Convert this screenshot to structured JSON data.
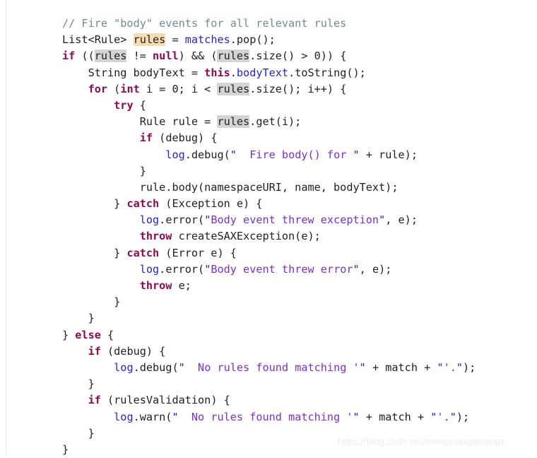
{
  "viewer": {
    "name": "java-source-code-snippet",
    "language": "Java",
    "background": "#ffffff"
  },
  "colors": {
    "comment": "#6f8c8c",
    "keyword": "#8e0a4c",
    "identifier": "#2323dd",
    "string": "#7a2fd4",
    "plain": "#202124",
    "highlight_active": "#f8dcb0",
    "highlight_occurrence": "#d4d4d4",
    "watermark": "#ececec"
  },
  "watermark": {
    "text": "https://blog.csdn.net/mengxiangqihangz"
  },
  "code": {
    "lines": [
      {
        "n": 1,
        "text": "// Fire \"body\" events for all relevant rules",
        "tokens": [
          {
            "t": "// Fire \"body\" events for all relevant rules",
            "c": "t-comment"
          }
        ]
      },
      {
        "n": 2,
        "text": "List<Rule> rules = matches.pop();",
        "tokens": [
          {
            "t": "List<Rule> ",
            "c": "t-plain"
          },
          {
            "t": "rules",
            "c": "t-plain",
            "hl": "hl-active"
          },
          {
            "t": " = ",
            "c": "t-plain"
          },
          {
            "t": "matches",
            "c": "t-ident"
          },
          {
            "t": ".pop();",
            "c": "t-plain"
          }
        ]
      },
      {
        "n": 3,
        "text": "if ((rules != null) && (rules.size() > 0)) {",
        "tokens": [
          {
            "t": "if",
            "c": "t-keyword"
          },
          {
            "t": " ((",
            "c": "t-plain"
          },
          {
            "t": "rules",
            "c": "t-plain",
            "hl": "hl-occur"
          },
          {
            "t": " != ",
            "c": "t-plain"
          },
          {
            "t": "null",
            "c": "t-keyword"
          },
          {
            "t": ") && (",
            "c": "t-plain"
          },
          {
            "t": "rules",
            "c": "t-plain",
            "hl": "hl-occur"
          },
          {
            "t": ".size() > 0)) {",
            "c": "t-plain"
          }
        ]
      },
      {
        "n": 4,
        "text": "    String bodyText = this.bodyText.toString();",
        "tokens": [
          {
            "t": "    String bodyText = ",
            "c": "t-plain"
          },
          {
            "t": "this",
            "c": "t-keyword"
          },
          {
            "t": ".",
            "c": "t-plain"
          },
          {
            "t": "bodyText",
            "c": "t-ident"
          },
          {
            "t": ".toString();",
            "c": "t-plain"
          }
        ]
      },
      {
        "n": 5,
        "text": "    for (int i = 0; i < rules.size(); i++) {",
        "tokens": [
          {
            "t": "    ",
            "c": "t-plain"
          },
          {
            "t": "for",
            "c": "t-keyword"
          },
          {
            "t": " (",
            "c": "t-plain"
          },
          {
            "t": "int",
            "c": "t-keyword"
          },
          {
            "t": " i = 0; i < ",
            "c": "t-plain"
          },
          {
            "t": "rules",
            "c": "t-plain",
            "hl": "hl-occur"
          },
          {
            "t": ".size(); i++) {",
            "c": "t-plain"
          }
        ]
      },
      {
        "n": 6,
        "text": "        try {",
        "tokens": [
          {
            "t": "        ",
            "c": "t-plain"
          },
          {
            "t": "try",
            "c": "t-keyword"
          },
          {
            "t": " {",
            "c": "t-plain"
          }
        ]
      },
      {
        "n": 7,
        "text": "            Rule rule = rules.get(i);",
        "tokens": [
          {
            "t": "            Rule rule = ",
            "c": "t-plain"
          },
          {
            "t": "rules",
            "c": "t-plain",
            "hl": "hl-occur"
          },
          {
            "t": ".get(i);",
            "c": "t-plain"
          }
        ]
      },
      {
        "n": 8,
        "text": "            if (debug) {",
        "tokens": [
          {
            "t": "            ",
            "c": "t-plain"
          },
          {
            "t": "if",
            "c": "t-keyword"
          },
          {
            "t": " (debug) {",
            "c": "t-plain"
          }
        ]
      },
      {
        "n": 9,
        "text": "                log.debug(\"  Fire body() for \" + rule);",
        "tokens": [
          {
            "t": "                ",
            "c": "t-plain"
          },
          {
            "t": "log",
            "c": "t-ident"
          },
          {
            "t": ".debug(",
            "c": "t-plain"
          },
          {
            "t": "\"",
            "c": "t-quote"
          },
          {
            "t": "  Fire body() for ",
            "c": "t-string"
          },
          {
            "t": "\"",
            "c": "t-quote"
          },
          {
            "t": " + rule);",
            "c": "t-plain"
          }
        ]
      },
      {
        "n": 10,
        "text": "            }",
        "tokens": [
          {
            "t": "            }",
            "c": "t-plain"
          }
        ]
      },
      {
        "n": 11,
        "text": "            rule.body(namespaceURI, name, bodyText);",
        "tokens": [
          {
            "t": "            rule.body(namespaceURI, name, bodyText);",
            "c": "t-plain"
          }
        ]
      },
      {
        "n": 12,
        "text": "        } catch (Exception e) {",
        "tokens": [
          {
            "t": "        } ",
            "c": "t-plain"
          },
          {
            "t": "catch",
            "c": "t-keyword"
          },
          {
            "t": " (Exception e) {",
            "c": "t-plain"
          }
        ]
      },
      {
        "n": 13,
        "text": "            log.error(\"Body event threw exception\", e);",
        "tokens": [
          {
            "t": "            ",
            "c": "t-plain"
          },
          {
            "t": "log",
            "c": "t-ident"
          },
          {
            "t": ".error(",
            "c": "t-plain"
          },
          {
            "t": "\"",
            "c": "t-quote"
          },
          {
            "t": "Body event threw exception",
            "c": "t-string"
          },
          {
            "t": "\"",
            "c": "t-quote"
          },
          {
            "t": ", e);",
            "c": "t-plain"
          }
        ]
      },
      {
        "n": 14,
        "text": "            throw createSAXException(e);",
        "tokens": [
          {
            "t": "            ",
            "c": "t-plain"
          },
          {
            "t": "throw",
            "c": "t-keyword"
          },
          {
            "t": " createSAXException(e);",
            "c": "t-plain"
          }
        ]
      },
      {
        "n": 15,
        "text": "        } catch (Error e) {",
        "tokens": [
          {
            "t": "        } ",
            "c": "t-plain"
          },
          {
            "t": "catch",
            "c": "t-keyword"
          },
          {
            "t": " (Error e) {",
            "c": "t-plain"
          }
        ]
      },
      {
        "n": 16,
        "text": "            log.error(\"Body event threw error\", e);",
        "tokens": [
          {
            "t": "            ",
            "c": "t-plain"
          },
          {
            "t": "log",
            "c": "t-ident"
          },
          {
            "t": ".error(",
            "c": "t-plain"
          },
          {
            "t": "\"",
            "c": "t-quote"
          },
          {
            "t": "Body event threw error",
            "c": "t-string"
          },
          {
            "t": "\"",
            "c": "t-quote"
          },
          {
            "t": ", e);",
            "c": "t-plain"
          }
        ]
      },
      {
        "n": 17,
        "text": "            throw e;",
        "tokens": [
          {
            "t": "            ",
            "c": "t-plain"
          },
          {
            "t": "throw",
            "c": "t-keyword"
          },
          {
            "t": " e;",
            "c": "t-plain"
          }
        ]
      },
      {
        "n": 18,
        "text": "        }",
        "tokens": [
          {
            "t": "        }",
            "c": "t-plain"
          }
        ]
      },
      {
        "n": 19,
        "text": "    }",
        "tokens": [
          {
            "t": "    }",
            "c": "t-plain"
          }
        ]
      },
      {
        "n": 20,
        "text": "} else {",
        "tokens": [
          {
            "t": "} ",
            "c": "t-plain"
          },
          {
            "t": "else",
            "c": "t-keyword"
          },
          {
            "t": " {",
            "c": "t-plain"
          }
        ]
      },
      {
        "n": 21,
        "text": "    if (debug) {",
        "tokens": [
          {
            "t": "    ",
            "c": "t-plain"
          },
          {
            "t": "if",
            "c": "t-keyword"
          },
          {
            "t": " (debug) {",
            "c": "t-plain"
          }
        ]
      },
      {
        "n": 22,
        "text": "        log.debug(\"  No rules found matching '\" + match + \"'.\");",
        "tokens": [
          {
            "t": "        ",
            "c": "t-plain"
          },
          {
            "t": "log",
            "c": "t-ident"
          },
          {
            "t": ".debug(",
            "c": "t-plain"
          },
          {
            "t": "\"",
            "c": "t-quote"
          },
          {
            "t": "  No rules found matching '",
            "c": "t-string"
          },
          {
            "t": "\"",
            "c": "t-quote"
          },
          {
            "t": " + match + ",
            "c": "t-plain"
          },
          {
            "t": "\"",
            "c": "t-quote"
          },
          {
            "t": "'.",
            "c": "t-string"
          },
          {
            "t": "\"",
            "c": "t-quote"
          },
          {
            "t": ");",
            "c": "t-plain"
          }
        ]
      },
      {
        "n": 23,
        "text": "    }",
        "tokens": [
          {
            "t": "    }",
            "c": "t-plain"
          }
        ]
      },
      {
        "n": 24,
        "text": "    if (rulesValidation) {",
        "tokens": [
          {
            "t": "    ",
            "c": "t-plain"
          },
          {
            "t": "if",
            "c": "t-keyword"
          },
          {
            "t": " (rulesValidation) {",
            "c": "t-plain"
          }
        ]
      },
      {
        "n": 25,
        "text": "        log.warn(\"  No rules found matching '\" + match + \"'.\");",
        "tokens": [
          {
            "t": "        ",
            "c": "t-plain"
          },
          {
            "t": "log",
            "c": "t-ident"
          },
          {
            "t": ".warn(",
            "c": "t-plain"
          },
          {
            "t": "\"",
            "c": "t-quote"
          },
          {
            "t": "  No rules found matching '",
            "c": "t-string"
          },
          {
            "t": "\"",
            "c": "t-quote"
          },
          {
            "t": " + match + ",
            "c": "t-plain"
          },
          {
            "t": "\"",
            "c": "t-quote"
          },
          {
            "t": "'.",
            "c": "t-string"
          },
          {
            "t": "\"",
            "c": "t-quote"
          },
          {
            "t": ");",
            "c": "t-plain"
          }
        ]
      },
      {
        "n": 26,
        "text": "    }",
        "tokens": [
          {
            "t": "    }",
            "c": "t-plain"
          }
        ]
      },
      {
        "n": 27,
        "text": "}",
        "tokens": [
          {
            "t": "}",
            "c": "t-plain"
          }
        ]
      }
    ]
  }
}
